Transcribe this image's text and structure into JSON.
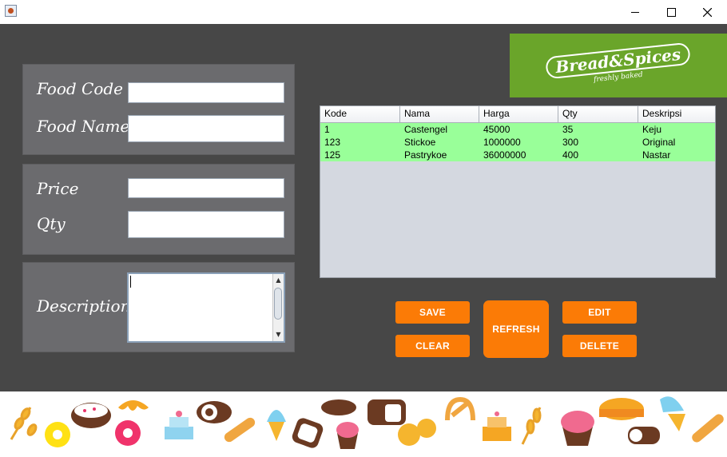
{
  "window": {
    "controls": {
      "minimize": "—",
      "maximize": "☐",
      "close": "✕"
    }
  },
  "form": {
    "food_code_label": "Food Code",
    "food_code_value": "",
    "food_name_label": "Food Name",
    "food_name_value": "",
    "price_label": "Price",
    "price_value": "",
    "qty_label": "Qty",
    "qty_value": "",
    "descriptions_label": "Descriptions",
    "descriptions_value": ""
  },
  "logo": {
    "title": "Bread&Spices",
    "subtitle": "freshly baked"
  },
  "table": {
    "columns": [
      "Kode",
      "Nama",
      "Harga",
      "Qty",
      "Deskripsi"
    ],
    "rows": [
      [
        "1",
        "Castengel",
        "45000",
        "35",
        "Keju"
      ],
      [
        "123",
        "Stickoe",
        "1000000",
        "300",
        "Original"
      ],
      [
        "125",
        "Pastrykoe",
        "36000000",
        "400",
        "Nastar"
      ]
    ]
  },
  "buttons": {
    "save": "SAVE",
    "clear": "CLEAR",
    "refresh": "REFRESH",
    "edit": "EDIT",
    "delete": "DELETE"
  },
  "colors": {
    "background": "#474747",
    "panel": "#6b6b6e",
    "accent": "#fb7b06",
    "row_highlight": "#99ff99",
    "logo_bg": "#6aa52a"
  },
  "footer_icons": [
    "wheat-icon",
    "donut-icon",
    "cake-icon",
    "donut-icon",
    "croissant-icon",
    "layer-cake-icon",
    "swiss-roll-icon",
    "baguette-icon",
    "ice-cream-icon",
    "toast-icon",
    "cupcake-icon",
    "bread-loaf-icon",
    "bread-icon",
    "buns-icon",
    "pretzel-icon",
    "layer-cake-icon",
    "wheat-icon",
    "muffin-icon",
    "pie-icon",
    "swiss-roll-icon",
    "ice-cream-icon",
    "baguette-icon"
  ]
}
